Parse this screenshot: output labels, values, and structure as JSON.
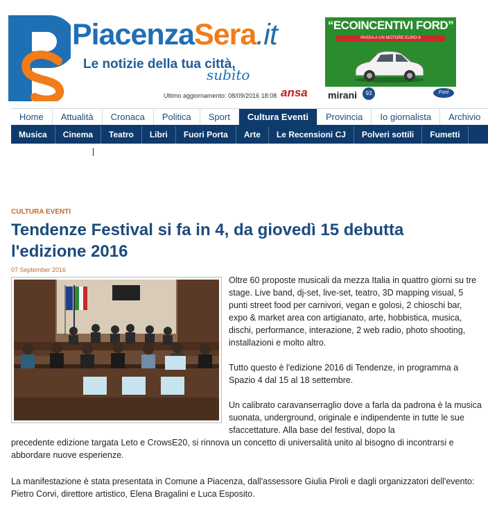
{
  "header": {
    "brand_part1": "Piacenza",
    "brand_part2": "Sera",
    "brand_part3": ".it",
    "tagline": "Le notizie della tua città,",
    "tagline_suffix": "subito",
    "last_update": "Ultimo aggiornamento: 08/09/2016 18:08",
    "ansa_logo": "ansa"
  },
  "ad": {
    "headline": "“ECOINCENTIVI FORD”",
    "subline": "PASSA A UN MOTORE EURO 6",
    "dealer": "mirani",
    "dealer_badge": "93",
    "brand": "Ford"
  },
  "nav_main": [
    {
      "label": "Home",
      "active": false
    },
    {
      "label": "Attualità",
      "active": false
    },
    {
      "label": "Cronaca",
      "active": false
    },
    {
      "label": "Politica",
      "active": false
    },
    {
      "label": "Sport",
      "active": false
    },
    {
      "label": "Cultura Eventi",
      "active": true
    },
    {
      "label": "Provincia",
      "active": false
    },
    {
      "label": "Io giornalista",
      "active": false
    },
    {
      "label": "Archivio",
      "active": false
    }
  ],
  "nav_sub": [
    {
      "label": "Musica"
    },
    {
      "label": "Cinema"
    },
    {
      "label": "Teatro"
    },
    {
      "label": "Libri"
    },
    {
      "label": "Fuori Porta"
    },
    {
      "label": "Arte"
    },
    {
      "label": "Le Recensioni CJ"
    },
    {
      "label": "Polveri sottili"
    },
    {
      "label": "Fumetti"
    }
  ],
  "article": {
    "category": "CULTURA EVENTI",
    "title": "Tendenze Festival si fa in 4, da giovedì 15 debutta l'edizione 2016",
    "date": "07 September 2016",
    "p1": "Oltre 60 proposte musicali da mezza Italia in quattro giorni su tre stage. Live band, dj-set, live-set, teatro, 3D mapping visual, 5 punti street food per carnivori, vegan e golosi, 2 chioschi bar, expo & market area con artigianato, arte, hobbistica, musica, dischi, performance, interazione, 2 web radio, photo shooting, installazioni e molto altro.",
    "p2": "Tutto questo è l'edizione 2016 di Tendenze, in programma a Spazio 4 dal 15 al 18 settembre.",
    "p3a": "Un calibrato caravanserraglio dove a farla da padrona è la musica suonata, underground, originale e indipendente in tutte le sue sfaccettature. Alla base del festival, dopo la",
    "p3b": "precedente edizione targata Leto e CrowsE20, si rinnova un concetto di universalità unito al bisogno di incontrarsi e abbordare nuove esperienze.",
    "p4": "La manifestazione è stata presentata in Comune a Piacenza, dall'assessore Giulia Piroli e dagli organizzatori dell'evento: Pietro Corvi, direttore artistico, Elena Bragalini e Luca Esposito."
  },
  "colors": {
    "brand_blue": "#1f6fb5",
    "brand_orange": "#f07c1a",
    "nav_dark": "#0e3a6c",
    "category_orange": "#c26a2a"
  }
}
